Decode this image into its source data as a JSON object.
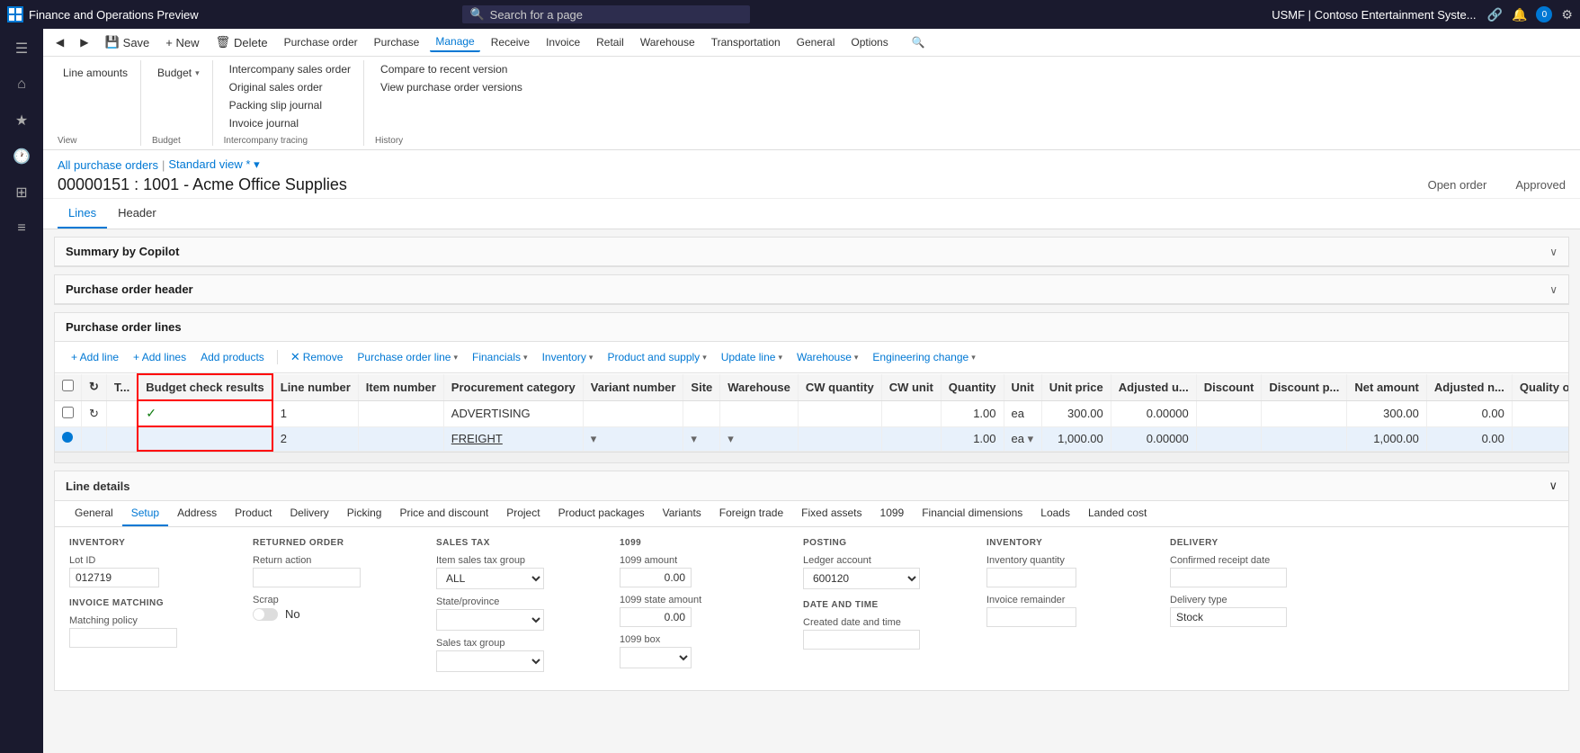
{
  "topbar": {
    "app_name": "Finance and Operations Preview",
    "search_placeholder": "Search for a page",
    "user_label": "USMF | Contoso Entertainment Syste...",
    "icons": [
      "grid-icon",
      "bell-icon",
      "settings-icon"
    ]
  },
  "sidenav": {
    "items": [
      {
        "name": "menu-icon",
        "symbol": "☰"
      },
      {
        "name": "home-icon",
        "symbol": "⌂"
      },
      {
        "name": "star-icon",
        "symbol": "★"
      },
      {
        "name": "clock-icon",
        "symbol": "🕐"
      },
      {
        "name": "grid-icon",
        "symbol": "⊞"
      },
      {
        "name": "list-icon",
        "symbol": "≡"
      }
    ]
  },
  "ribbon": {
    "tabs": [
      {
        "label": "Purchase order",
        "active": false
      },
      {
        "label": "Purchase",
        "active": false
      },
      {
        "label": "Manage",
        "active": true
      },
      {
        "label": "Receive",
        "active": false
      },
      {
        "label": "Invoice",
        "active": false
      },
      {
        "label": "Retail",
        "active": false
      },
      {
        "label": "Warehouse",
        "active": false
      },
      {
        "label": "Transportation",
        "active": false
      },
      {
        "label": "General",
        "active": false
      },
      {
        "label": "Options",
        "active": false
      }
    ],
    "groups": [
      {
        "label": "View",
        "items": [
          {
            "label": "Line amounts"
          }
        ]
      },
      {
        "label": "Budget",
        "items": [
          {
            "label": "Budget ▾"
          },
          {
            "label": "Intercompany sales order"
          },
          {
            "label": "Original sales order"
          }
        ],
        "sublabel": "Intercompany tracing"
      },
      {
        "label": "Intercompany tracing",
        "items": [
          {
            "label": "Intercompany sales order"
          },
          {
            "label": "Original sales order"
          },
          {
            "label": "Packing slip journal"
          },
          {
            "label": "Invoice journal"
          }
        ]
      },
      {
        "label": "History",
        "items": [
          {
            "label": "Compare to recent version"
          },
          {
            "label": "View purchase order versions"
          }
        ]
      }
    ],
    "save_label": "Save",
    "new_label": "+ New",
    "delete_label": "Delete",
    "purchase_order_label": "Purchase order",
    "purchase_label": "Purchase",
    "manage_label": "Manage"
  },
  "breadcrumb": {
    "link": "All purchase orders",
    "view": "Standard view *"
  },
  "page": {
    "title": "00000151 : 1001 - Acme Office Supplies",
    "status_left": "Open order",
    "status_right": "Approved"
  },
  "page_tabs": [
    {
      "label": "Lines",
      "active": true
    },
    {
      "label": "Header",
      "active": false
    }
  ],
  "sections": {
    "summary_copilot": {
      "title": "Summary by Copilot"
    },
    "po_header": {
      "title": "Purchase order header"
    },
    "po_lines": {
      "title": "Purchase order lines"
    }
  },
  "po_lines_toolbar": [
    {
      "label": "+ Add line",
      "type": "btn"
    },
    {
      "label": "+ Add lines",
      "type": "btn"
    },
    {
      "label": "Add products",
      "type": "btn"
    },
    {
      "type": "sep"
    },
    {
      "label": "Remove",
      "type": "btn"
    },
    {
      "label": "Purchase order line ▾",
      "type": "btn"
    },
    {
      "label": "Financials ▾",
      "type": "btn"
    },
    {
      "label": "Inventory ▾",
      "type": "btn"
    },
    {
      "label": "Product and supply ▾",
      "type": "btn"
    },
    {
      "label": "Update line ▾",
      "type": "btn"
    },
    {
      "label": "Warehouse ▾",
      "type": "btn"
    },
    {
      "label": "Engineering change ▾",
      "type": "btn"
    }
  ],
  "po_table": {
    "columns": [
      {
        "key": "sel",
        "label": ""
      },
      {
        "key": "refresh",
        "label": ""
      },
      {
        "key": "T",
        "label": "T..."
      },
      {
        "key": "budget_check",
        "label": "Budget check results",
        "highlight": true
      },
      {
        "key": "line_number",
        "label": "Line number"
      },
      {
        "key": "item_number",
        "label": "Item number"
      },
      {
        "key": "procurement_category",
        "label": "Procurement category"
      },
      {
        "key": "variant_number",
        "label": "Variant number"
      },
      {
        "key": "site",
        "label": "Site"
      },
      {
        "key": "warehouse",
        "label": "Warehouse"
      },
      {
        "key": "cw_quantity",
        "label": "CW quantity"
      },
      {
        "key": "cw_unit",
        "label": "CW unit"
      },
      {
        "key": "quantity",
        "label": "Quantity"
      },
      {
        "key": "unit",
        "label": "Unit"
      },
      {
        "key": "unit_price",
        "label": "Unit price"
      },
      {
        "key": "adjusted_u",
        "label": "Adjusted u..."
      },
      {
        "key": "discount",
        "label": "Discount"
      },
      {
        "key": "discount_p",
        "label": "Discount p..."
      },
      {
        "key": "net_amount",
        "label": "Net amount"
      },
      {
        "key": "adjusted_n",
        "label": "Adjusted n..."
      },
      {
        "key": "quality_order_sta",
        "label": "Quality order sta..."
      }
    ],
    "rows": [
      {
        "sel": false,
        "is_selected": false,
        "budget_check_icon": "✓",
        "line_number": "1",
        "item_number": "",
        "procurement_category": "ADVERTISING",
        "variant_number": "",
        "site": "",
        "warehouse": "",
        "cw_quantity": "",
        "cw_unit": "",
        "quantity": "1.00",
        "unit": "ea",
        "unit_price": "300.00",
        "adjusted_u": "0.00000",
        "discount": "",
        "discount_p": "",
        "net_amount": "300.00",
        "adjusted_n": "0.00",
        "quality_order_sta": ""
      },
      {
        "sel": true,
        "is_selected": true,
        "budget_check_icon": "",
        "line_number": "2",
        "item_number": "",
        "procurement_category": "FREIGHT",
        "variant_number": "",
        "site": "",
        "warehouse": "",
        "cw_quantity": "",
        "cw_unit": "",
        "quantity": "1.00",
        "unit": "ea",
        "unit_price": "1,000.00",
        "adjusted_u": "0.00000",
        "discount": "",
        "discount_p": "",
        "net_amount": "1,000.00",
        "adjusted_n": "0.00",
        "quality_order_sta": ""
      }
    ]
  },
  "line_details": {
    "title": "Line details",
    "tabs": [
      {
        "label": "General",
        "active": false
      },
      {
        "label": "Setup",
        "active": true
      },
      {
        "label": "Address",
        "active": false
      },
      {
        "label": "Product",
        "active": false
      },
      {
        "label": "Delivery",
        "active": false
      },
      {
        "label": "Picking",
        "active": false
      },
      {
        "label": "Price and discount",
        "active": false
      },
      {
        "label": "Project",
        "active": false
      },
      {
        "label": "Product packages",
        "active": false
      },
      {
        "label": "Variants",
        "active": false
      },
      {
        "label": "Foreign trade",
        "active": false
      },
      {
        "label": "Fixed assets",
        "active": false
      },
      {
        "label": "1099",
        "active": false
      },
      {
        "label": "Financial dimensions",
        "active": false
      },
      {
        "label": "Loads",
        "active": false
      },
      {
        "label": "Landed cost",
        "active": false
      }
    ],
    "inventory_section": {
      "label": "INVENTORY",
      "lot_id_label": "Lot ID",
      "lot_id_value": "012719"
    },
    "invoice_matching_section": {
      "label": "INVOICE MATCHING",
      "matching_policy_label": "Matching policy"
    },
    "returned_order_section": {
      "label": "RETURNED ORDER",
      "return_action_label": "Return action",
      "return_action_value": "",
      "scrap_label": "Scrap",
      "scrap_value": "No"
    },
    "sales_tax_section": {
      "label": "SALES TAX",
      "item_sales_tax_group_label": "Item sales tax group",
      "item_sales_tax_group_value": "ALL",
      "state_province_label": "State/province",
      "state_province_value": "",
      "sales_tax_group_label": "Sales tax group",
      "sales_tax_group_value": ""
    },
    "form_1099_section": {
      "label": "1099",
      "amount_label": "1099 amount",
      "amount_value": "0.00",
      "state_amount_label": "1099 state amount",
      "state_amount_value": "0.00",
      "box_label": "1099 box",
      "box_value": ""
    },
    "posting_section": {
      "label": "POSTING",
      "ledger_account_label": "Ledger account",
      "ledger_account_value": "600120"
    },
    "date_time_section": {
      "label": "DATE AND TIME",
      "created_date_label": "Created date and time"
    },
    "inventory_right_section": {
      "label": "INVENTORY",
      "inventory_quantity_label": "Inventory quantity",
      "invoice_remainder_label": "Invoice remainder"
    },
    "delivery_section": {
      "label": "DELIVERY",
      "confirmed_receipt_date_label": "Confirmed receipt date",
      "delivery_type_label": "Delivery type",
      "delivery_type_value": "Stock"
    }
  }
}
